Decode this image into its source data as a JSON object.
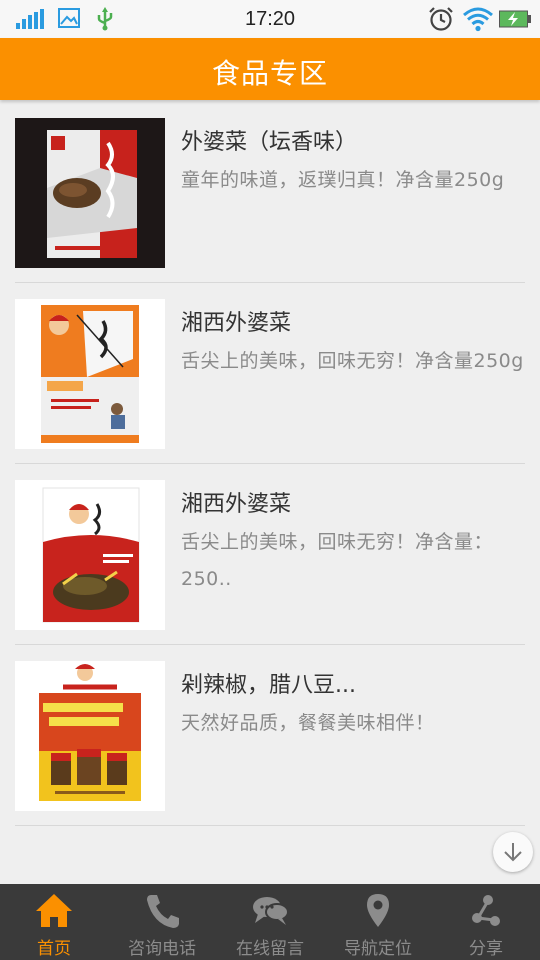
{
  "status_bar": {
    "time": "17:20"
  },
  "header": {
    "title": "食品专区"
  },
  "products": [
    {
      "title": "外婆菜（坛香味）",
      "desc": "童年的味道，返璞归真！净含量250g",
      "thumb": "product-image-1"
    },
    {
      "title": "湘西外婆菜",
      "desc": "舌尖上的美味，回味无穷！净含量250g",
      "thumb": "product-image-2"
    },
    {
      "title": "湘西外婆菜",
      "desc": "舌尖上的美味，回味无穷！净含量：250..",
      "thumb": "product-image-3"
    },
    {
      "title": "剁辣椒，腊八豆...",
      "desc": "天然好品质，餐餐美味相伴！",
      "thumb": "product-image-4"
    }
  ],
  "bottom_nav": [
    {
      "label": "首页",
      "icon": "home-icon",
      "active": true
    },
    {
      "label": "咨询电话",
      "icon": "phone-icon",
      "active": false
    },
    {
      "label": "在线留言",
      "icon": "chat-bubbles-icon",
      "active": false
    },
    {
      "label": "导航定位",
      "icon": "map-pin-icon",
      "active": false
    },
    {
      "label": "分享",
      "icon": "share-icon",
      "active": false
    }
  ],
  "colors": {
    "accent": "#fb9000",
    "nav_bg": "#3a3a3a",
    "status_icon_blue": "#2a9be0",
    "usb_green": "#4caf50"
  }
}
